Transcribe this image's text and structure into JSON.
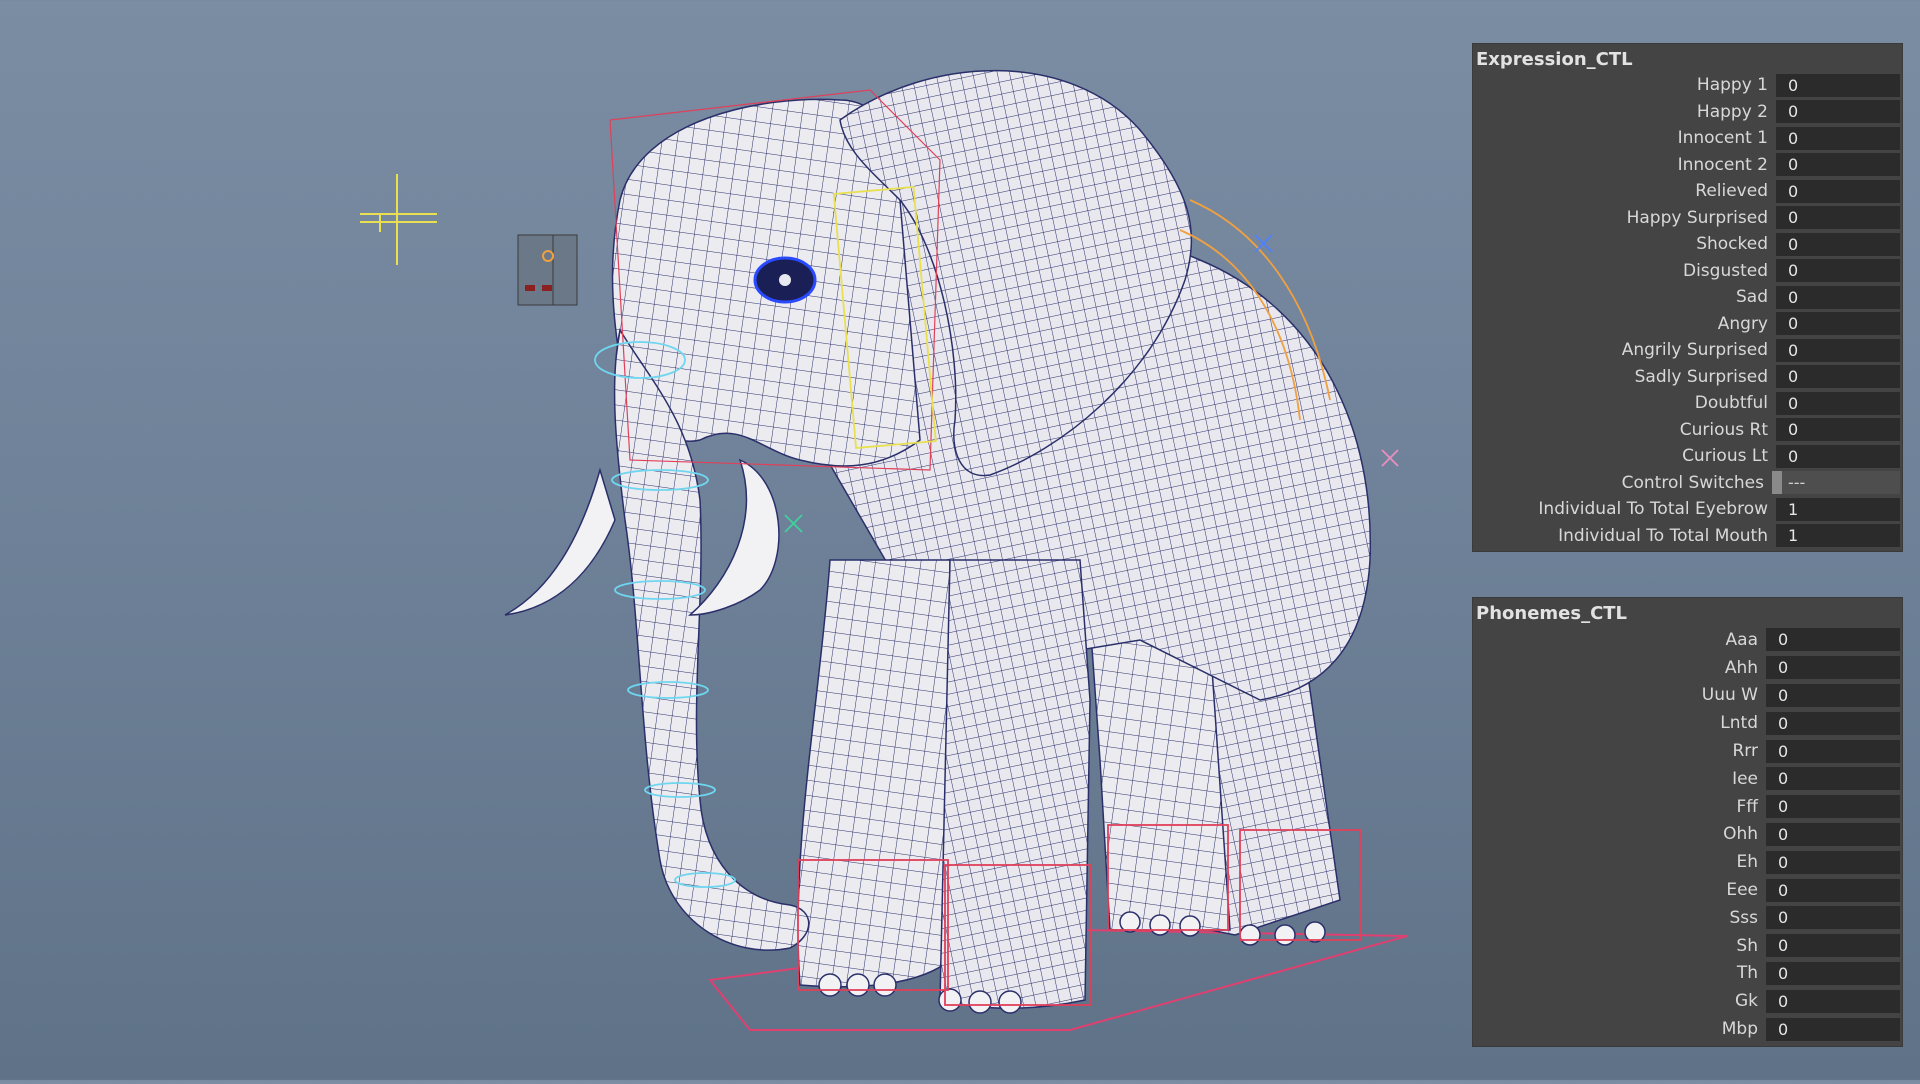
{
  "expression_panel": {
    "title": "Expression_CTL",
    "attributes": [
      {
        "label": "Happy 1",
        "value": "0"
      },
      {
        "label": "Happy 2",
        "value": "0"
      },
      {
        "label": "Innocent 1",
        "value": "0"
      },
      {
        "label": "Innocent 2",
        "value": "0"
      },
      {
        "label": "Relieved",
        "value": "0"
      },
      {
        "label": "Happy Surprised",
        "value": "0"
      },
      {
        "label": "Shocked",
        "value": "0"
      },
      {
        "label": "Disgusted",
        "value": "0"
      },
      {
        "label": "Sad",
        "value": "0"
      },
      {
        "label": "Angry",
        "value": "0"
      },
      {
        "label": "Angrily Surprised",
        "value": "0"
      },
      {
        "label": "Sadly Surprised",
        "value": "0"
      },
      {
        "label": "Doubtful",
        "value": "0"
      },
      {
        "label": "Curious Rt",
        "value": "0"
      },
      {
        "label": "Curious Lt",
        "value": "0"
      },
      {
        "label": "Control Switches",
        "value": "---"
      },
      {
        "label": "Individual To Total Eyebrow",
        "value": "1"
      },
      {
        "label": "Individual To Total Mouth",
        "value": "1"
      }
    ]
  },
  "phonemes_panel": {
    "title": "Phonemes_CTL",
    "attributes": [
      {
        "label": "Aaa",
        "value": "0"
      },
      {
        "label": "Ahh",
        "value": "0"
      },
      {
        "label": "Uuu W",
        "value": "0"
      },
      {
        "label": "Lntd",
        "value": "0"
      },
      {
        "label": "Rrr",
        "value": "0"
      },
      {
        "label": "Iee",
        "value": "0"
      },
      {
        "label": "Fff",
        "value": "0"
      },
      {
        "label": "Ohh",
        "value": "0"
      },
      {
        "label": "Eh",
        "value": "0"
      },
      {
        "label": "Eee",
        "value": "0"
      },
      {
        "label": "Sss",
        "value": "0"
      },
      {
        "label": "Sh",
        "value": "0"
      },
      {
        "label": "Th",
        "value": "0"
      },
      {
        "label": "Gk",
        "value": "0"
      },
      {
        "label": "Mbp",
        "value": "0"
      }
    ]
  },
  "viewport": {
    "model_icon": "elephant-wireframe-model",
    "colors": {
      "background_top": "#7b8da3",
      "background_bottom": "#5f7288",
      "mesh_fill": "#ecebf0",
      "wire": "#2a2f6a",
      "rig_red": "#e0405a",
      "rig_cyan": "#6fd6f0",
      "rig_yellow": "#e8e050",
      "rig_orange": "#f0a040"
    }
  }
}
